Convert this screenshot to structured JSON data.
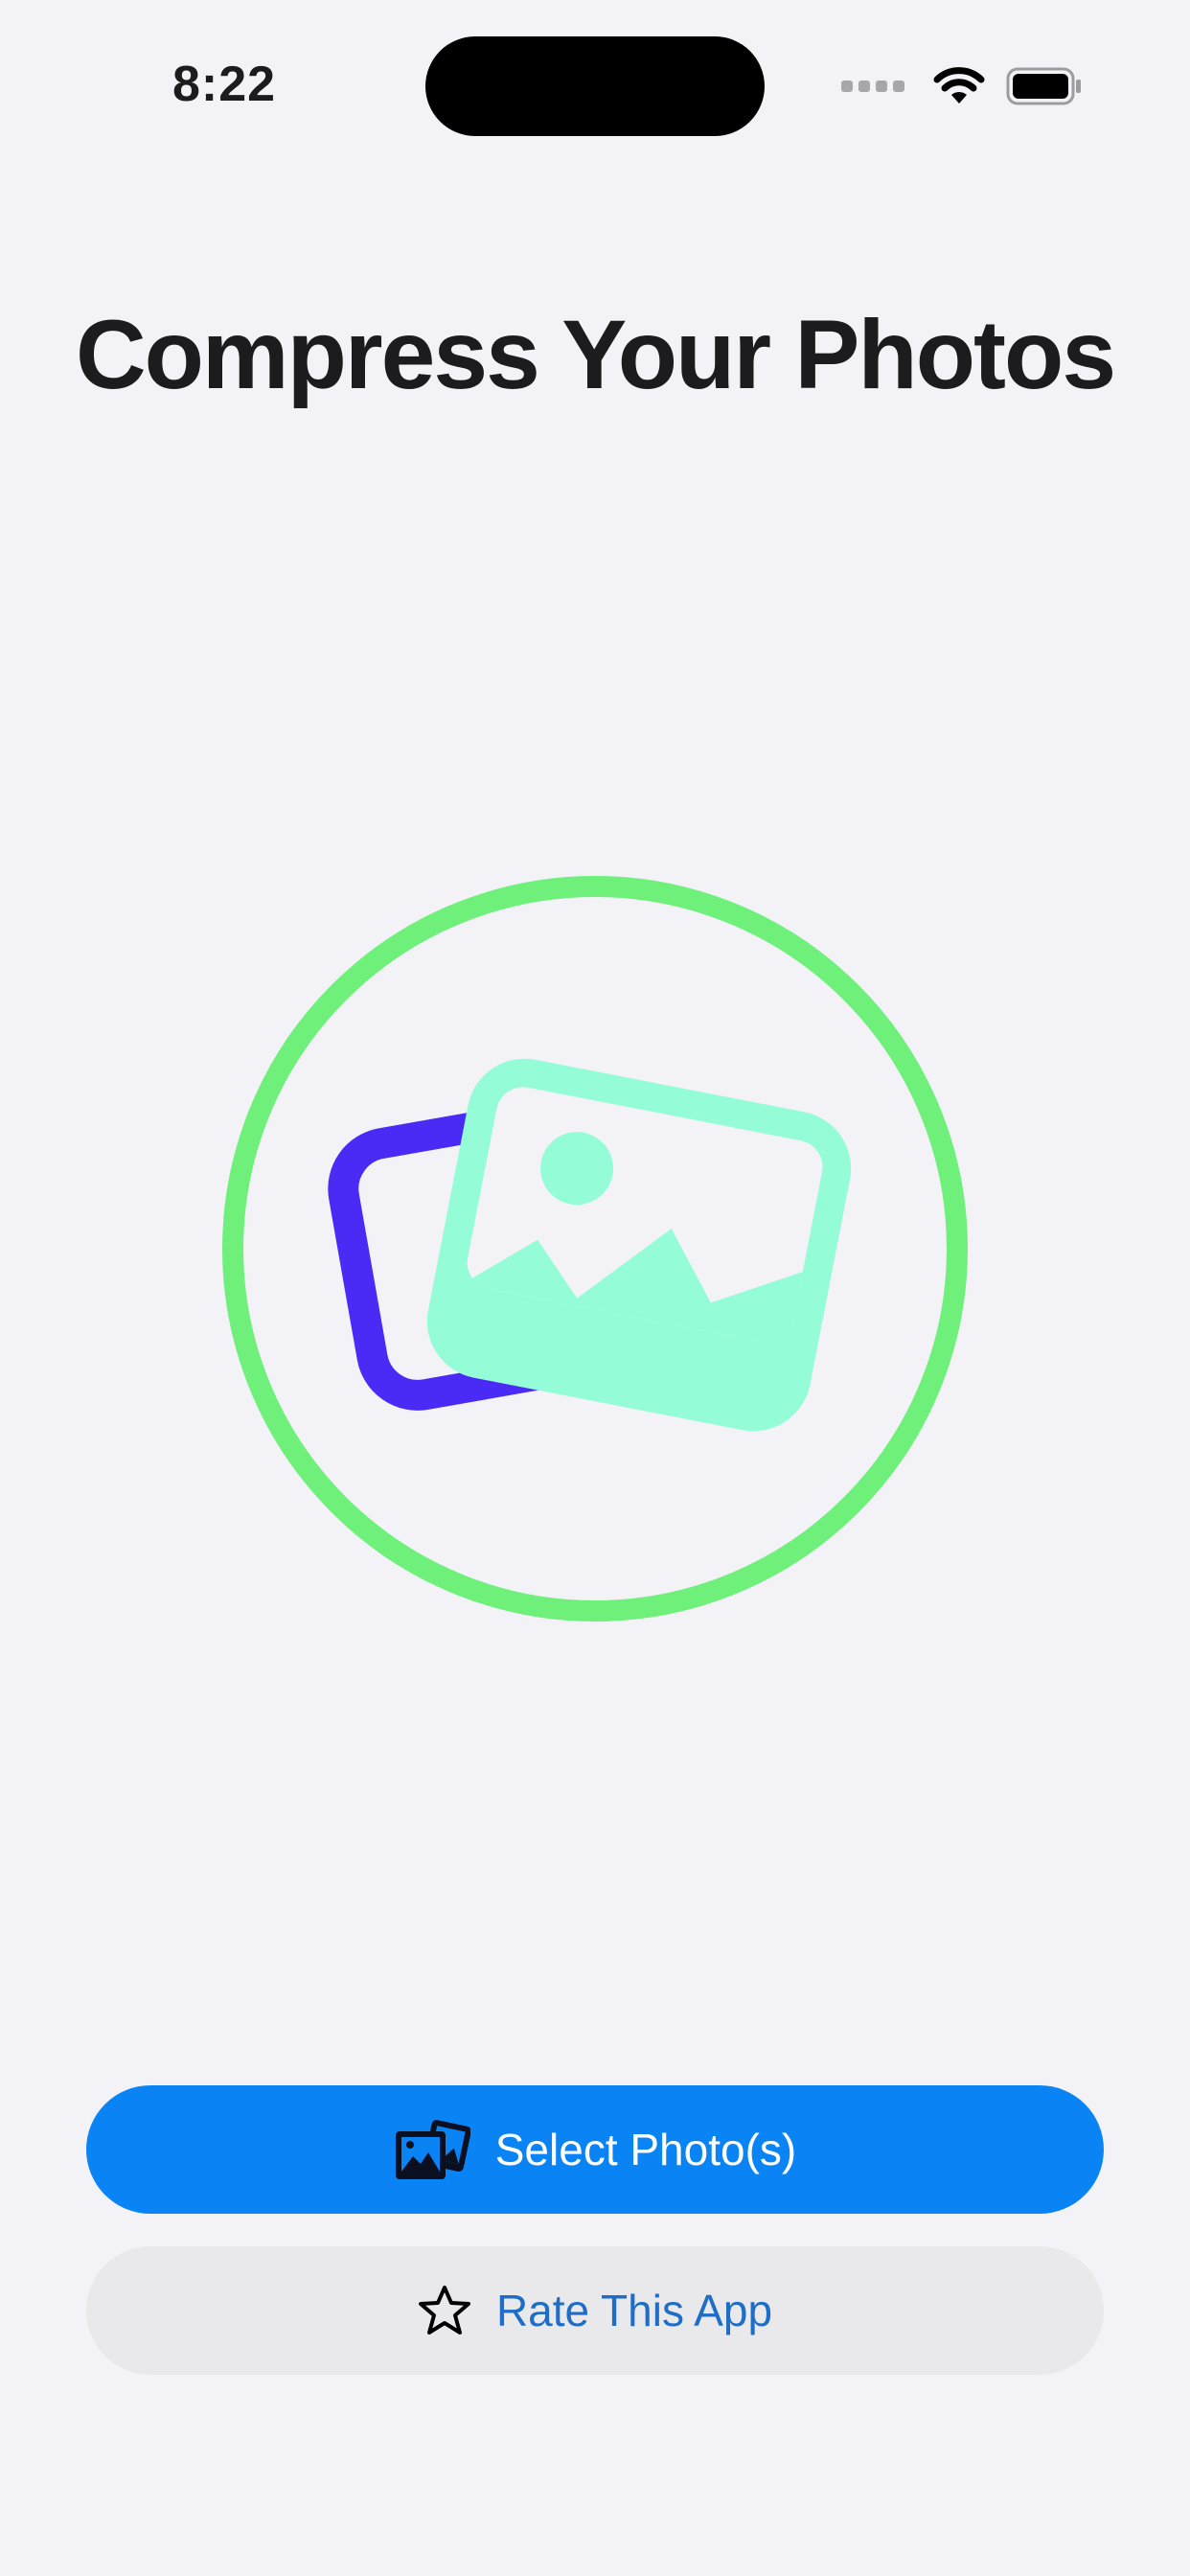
{
  "status_bar": {
    "time": "8:22",
    "wifi_icon": "wifi-icon",
    "battery_icon": "battery-icon",
    "cellular_icon": "cellular-signal-icon"
  },
  "title": "Compress Your Photos",
  "hero": {
    "icon": "photos-stack-icon",
    "ring_color": "#6EF07B",
    "back_photo_color": "#4A2BF5",
    "front_photo_color": "#94FDD8"
  },
  "buttons": {
    "select": {
      "label": "Select Photo(s)",
      "icon": "photo-stack-icon",
      "color": "#0A84F5"
    },
    "rate": {
      "label": "Rate This App",
      "icon": "star-icon",
      "color": "#E9E9EB"
    }
  }
}
